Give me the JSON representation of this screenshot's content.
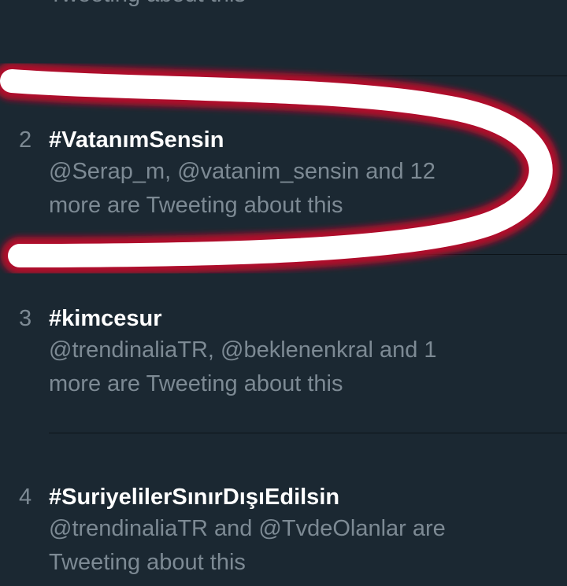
{
  "top_partial": {
    "desc": "Tweeting about this"
  },
  "trends": [
    {
      "rank": "2",
      "tag": "#VatanımSensin",
      "desc": "@Serap_m, @vatanim_sensin and 12 more are Tweeting about this"
    },
    {
      "rank": "3",
      "tag": "#kimcesur",
      "desc": "@trendinaliaTR, @beklenenkral and 1 more are Tweeting about this"
    },
    {
      "rank": "4",
      "tag": "#SuriyelilerSınırDışıEdilsin",
      "desc": "@trendinaliaTR and @TvdeOlanlar are Tweeting about this"
    }
  ],
  "colors": {
    "background": "#1b2832",
    "secondary_text": "#7d8a94",
    "primary_text": "#ffffff",
    "highlight_stroke": "#ffffff",
    "highlight_glow": "#b0102a"
  }
}
